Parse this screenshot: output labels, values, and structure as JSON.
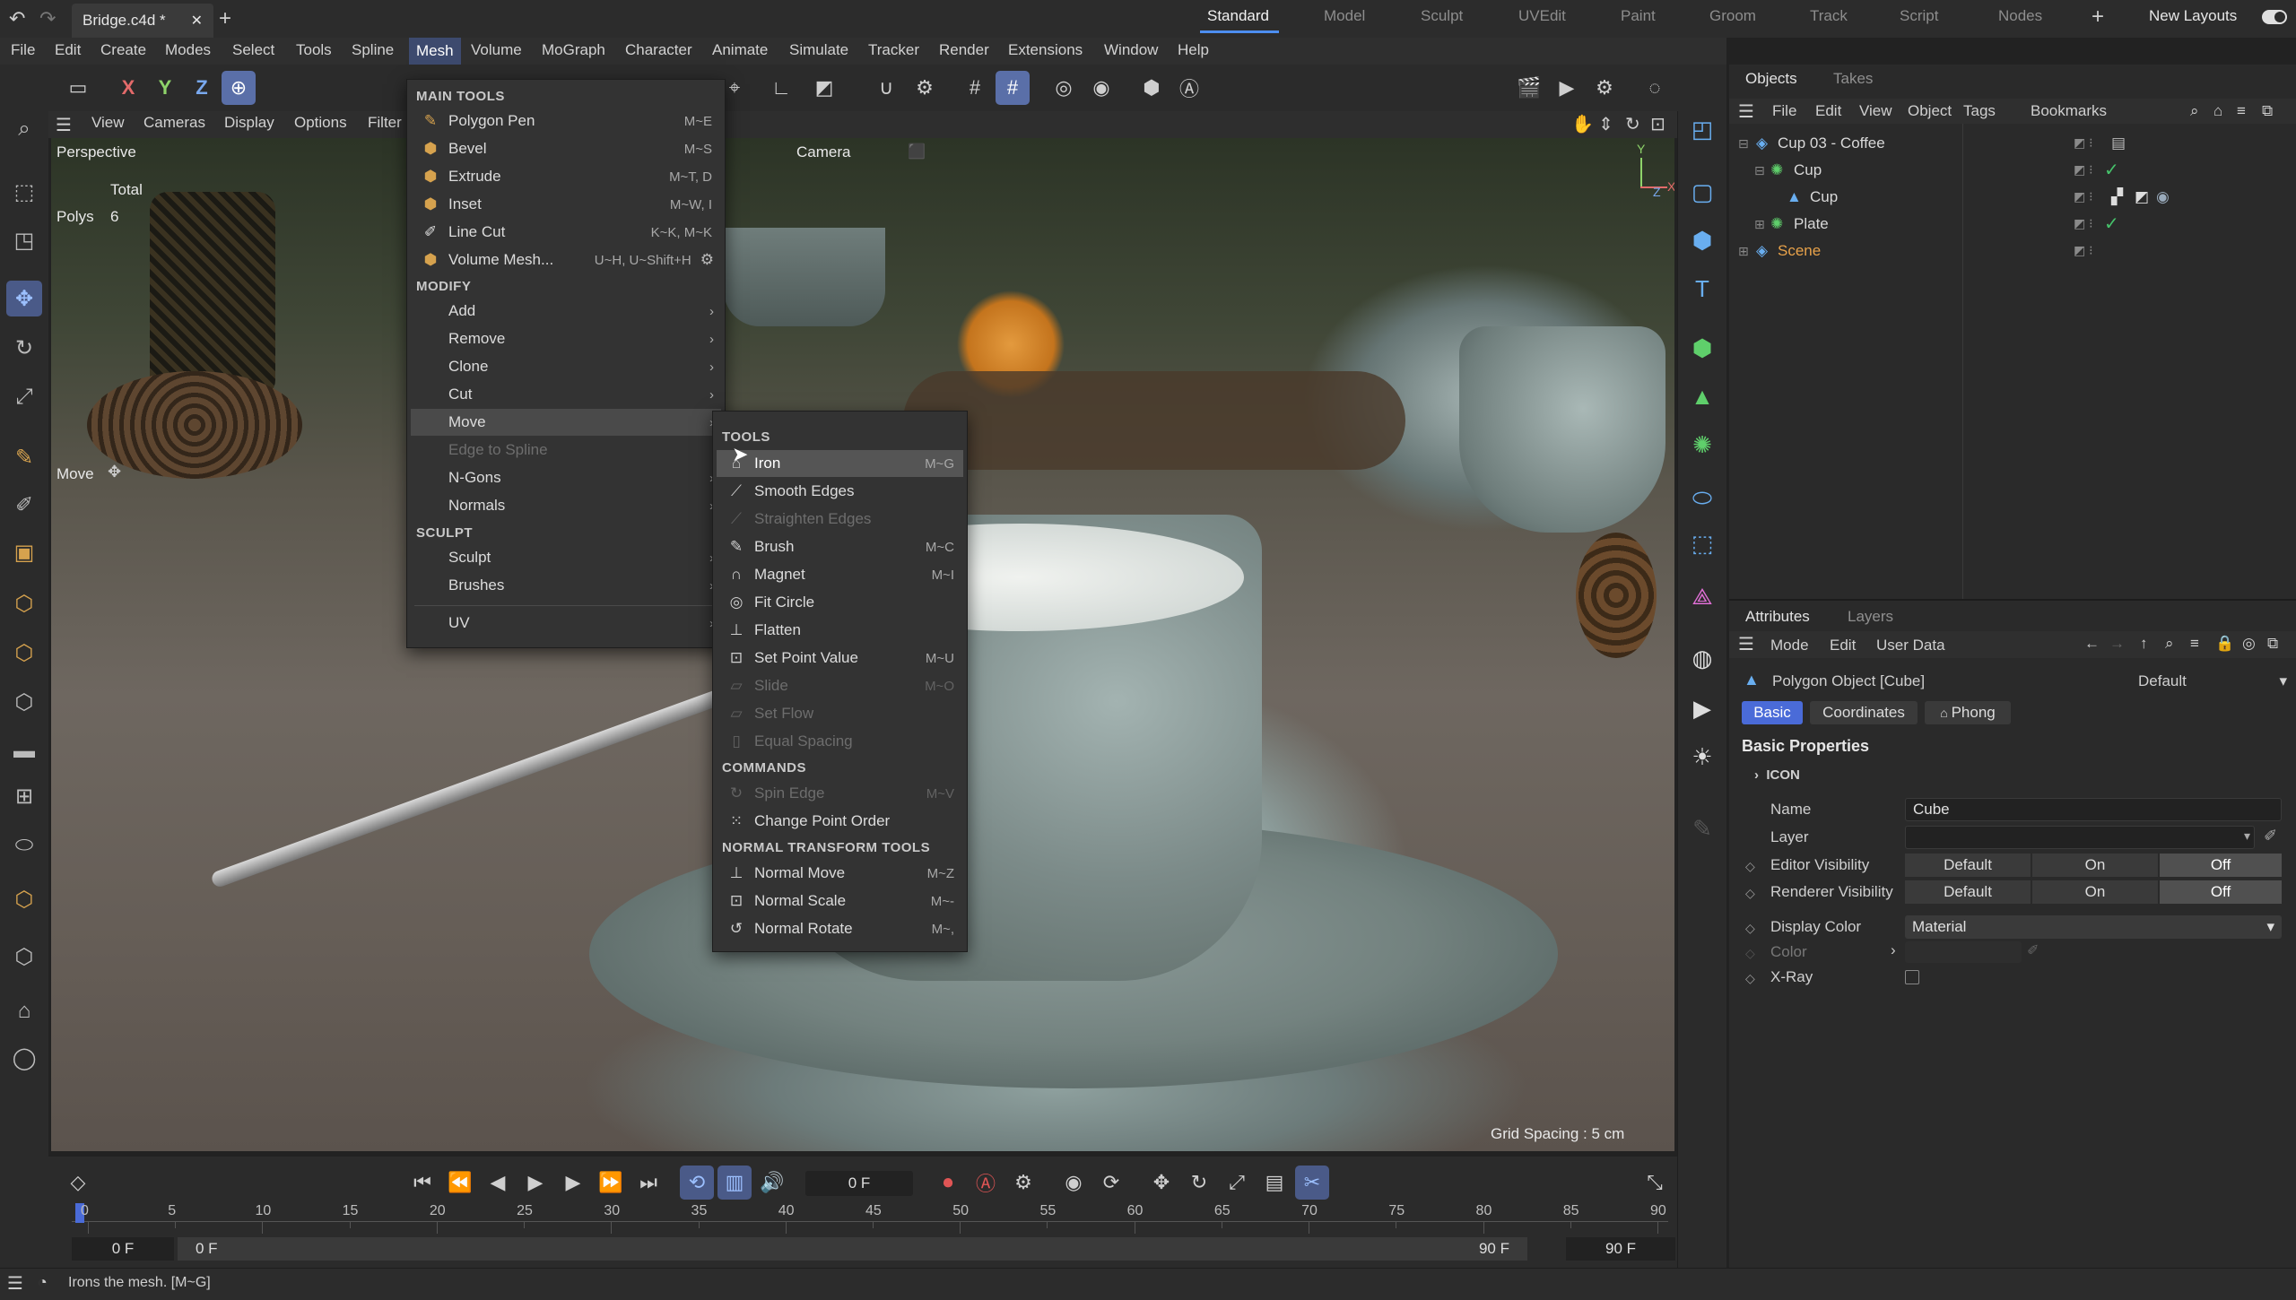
{
  "titlebar": {
    "file_tab": "Bridge.c4d *",
    "workspaces": [
      "Standard",
      "Model",
      "Sculpt",
      "UVEdit",
      "Paint",
      "Groom",
      "Track",
      "Script",
      "Nodes"
    ],
    "active_workspace": "Standard",
    "new_layouts": "New Layouts"
  },
  "menubar": [
    "File",
    "Edit",
    "Create",
    "Modes",
    "Select",
    "Tools",
    "Spline",
    "Mesh",
    "Volume",
    "MoGraph",
    "Character",
    "Animate",
    "Simulate",
    "Tracker",
    "Render",
    "Extensions",
    "Window",
    "Help"
  ],
  "toolbar": {
    "axis_x": "X",
    "axis_y": "Y",
    "axis_z": "Z"
  },
  "viewport": {
    "menu": [
      "View",
      "Cameras",
      "Display",
      "Options",
      "Filter"
    ],
    "view_name": "Perspective",
    "camera_label": "Camera",
    "stats_total": "Total",
    "stats_polys_label": "Polys",
    "stats_polys_value": "6",
    "move_label": "Move",
    "grid_spacing": "Grid Spacing : 5 cm",
    "axis_y": "Y",
    "axis_x": "X",
    "axis_z": "Z"
  },
  "mesh_menu": {
    "sections": {
      "main_tools": "MAIN TOOLS",
      "modify": "MODIFY",
      "sculpt": "SCULPT"
    },
    "main_tools": [
      {
        "label": "Polygon Pen",
        "shortcut": "M~E"
      },
      {
        "label": "Bevel",
        "shortcut": "M~S"
      },
      {
        "label": "Extrude",
        "shortcut": "M~T, D"
      },
      {
        "label": "Inset",
        "shortcut": "M~W, I"
      },
      {
        "label": "Line Cut",
        "shortcut": "K~K, M~K"
      },
      {
        "label": "Volume Mesh...",
        "shortcut": "U~H, U~Shift+H"
      }
    ],
    "modify": [
      "Add",
      "Remove",
      "Clone",
      "Cut",
      "Move",
      "Edge to Spline",
      "N-Gons",
      "Normals"
    ],
    "sculpt": [
      "Sculpt",
      "Brushes"
    ],
    "uv": "UV"
  },
  "move_submenu": {
    "sections": {
      "tools": "TOOLS",
      "commands": "COMMANDS",
      "normal_transform": "NORMAL TRANSFORM TOOLS"
    },
    "tools": [
      {
        "label": "Iron",
        "shortcut": "M~G"
      },
      {
        "label": "Smooth Edges",
        "shortcut": ""
      },
      {
        "label": "Straighten Edges",
        "shortcut": ""
      },
      {
        "label": "Brush",
        "shortcut": "M~C"
      },
      {
        "label": "Magnet",
        "shortcut": "M~I"
      },
      {
        "label": "Fit Circle",
        "shortcut": ""
      },
      {
        "label": "Flatten",
        "shortcut": ""
      },
      {
        "label": "Set Point Value",
        "shortcut": "M~U"
      },
      {
        "label": "Slide",
        "shortcut": "M~O"
      },
      {
        "label": "Set Flow",
        "shortcut": ""
      },
      {
        "label": "Equal Spacing",
        "shortcut": ""
      }
    ],
    "commands": [
      {
        "label": "Spin Edge",
        "shortcut": "M~V"
      },
      {
        "label": "Change Point Order",
        "shortcut": ""
      }
    ],
    "normal_transform": [
      {
        "label": "Normal Move",
        "shortcut": "M~Z"
      },
      {
        "label": "Normal Scale",
        "shortcut": "M~-"
      },
      {
        "label": "Normal Rotate",
        "shortcut": "M~,"
      }
    ]
  },
  "objects_panel": {
    "tabs": [
      "Objects",
      "Takes"
    ],
    "menu": [
      "File",
      "Edit",
      "View",
      "Object",
      "Tags",
      "Bookmarks"
    ],
    "tree": [
      {
        "name": "Cup 03 - Coffee"
      },
      {
        "name": "Cup"
      },
      {
        "name": "Cup"
      },
      {
        "name": "Plate"
      },
      {
        "name": "Scene"
      }
    ]
  },
  "attributes_panel": {
    "tabs": [
      "Attributes",
      "Layers"
    ],
    "menu": [
      "Mode",
      "Edit",
      "User Data"
    ],
    "object_title": "Polygon Object [Cube]",
    "preset": "Default",
    "subtabs": [
      "Basic",
      "Coordinates",
      "Phong"
    ],
    "section_title": "Basic Properties",
    "group_icon": "ICON",
    "fields": {
      "name_label": "Name",
      "name_value": "Cube",
      "layer_label": "Layer",
      "editor_visibility_label": "Editor Visibility",
      "renderer_visibility_label": "Renderer Visibility",
      "vis_default": "Default",
      "vis_on": "On",
      "vis_off": "Off",
      "display_color_label": "Display Color",
      "display_color_value": "Material",
      "color_label": "Color",
      "xray_label": "X-Ray"
    }
  },
  "timeline": {
    "current_frame": "0 F",
    "ticks": [
      "0",
      "5",
      "10",
      "15",
      "20",
      "25",
      "30",
      "35",
      "40",
      "45",
      "50",
      "55",
      "60",
      "65",
      "70",
      "75",
      "80",
      "85",
      "90"
    ],
    "range_start": "0 F",
    "range_start2": "0 F",
    "range_end": "90 F",
    "range_end2": "90 F"
  },
  "status": {
    "text": "Irons the mesh. [M~G]"
  }
}
